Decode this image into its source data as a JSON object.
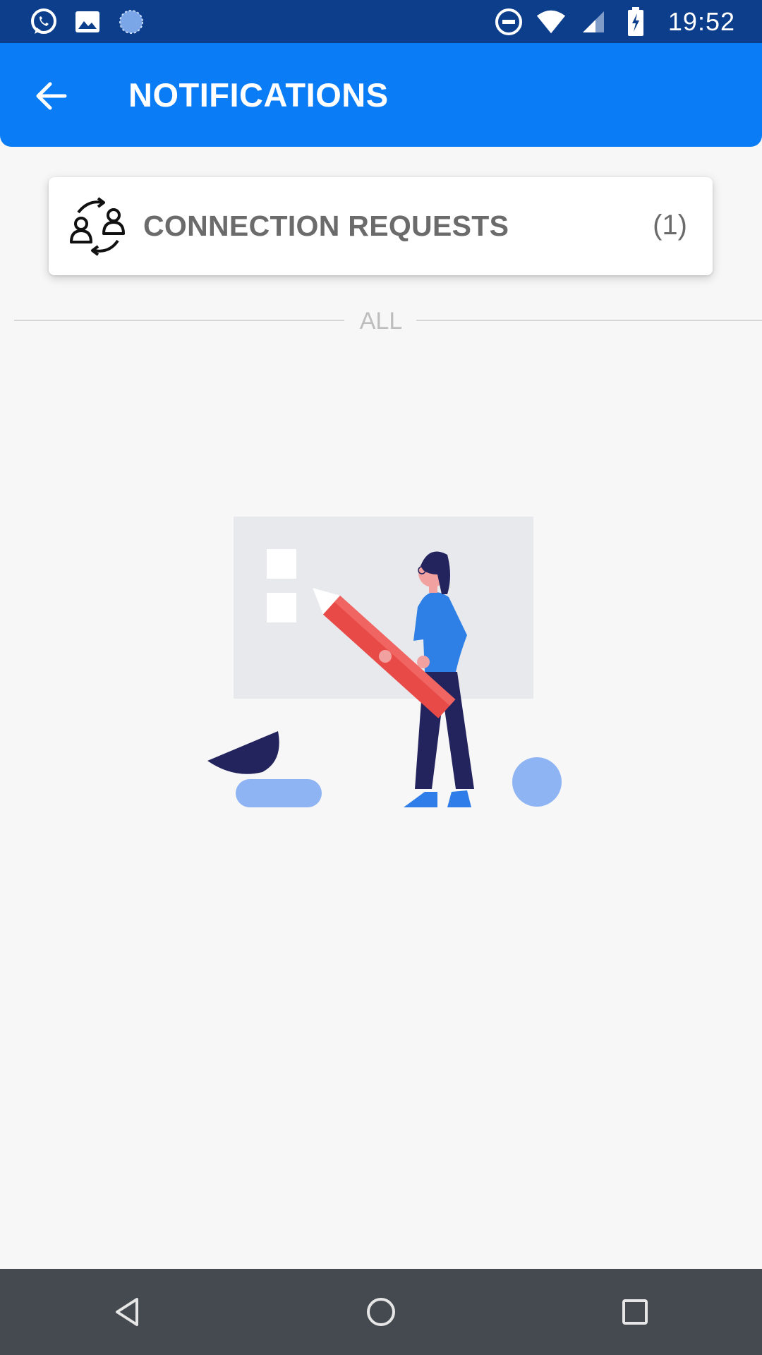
{
  "status_bar": {
    "time": "19:52",
    "left_icons": [
      "whatsapp-icon",
      "image-icon",
      "sync-icon"
    ],
    "right_icons": [
      "do-not-disturb-icon",
      "wifi-icon",
      "signal-icon",
      "battery-charging-icon"
    ]
  },
  "app_bar": {
    "title": "NOTIFICATIONS",
    "back_icon": "arrow-left-icon",
    "color": "#0a7cf5"
  },
  "connection_card": {
    "label": "CONNECTION REQUESTS",
    "count": "(1)",
    "icon": "people-exchange-icon"
  },
  "divider": {
    "label": "ALL"
  },
  "empty_state": {
    "illustration": "woman-with-pencil-illustration"
  },
  "nav_bar": {
    "buttons": [
      "back-triangle-icon",
      "home-circle-icon",
      "recents-square-icon"
    ]
  },
  "colors": {
    "status_bar": "#0d3e8c",
    "accent": "#0a7cf5",
    "nav_bar": "#454a50"
  }
}
